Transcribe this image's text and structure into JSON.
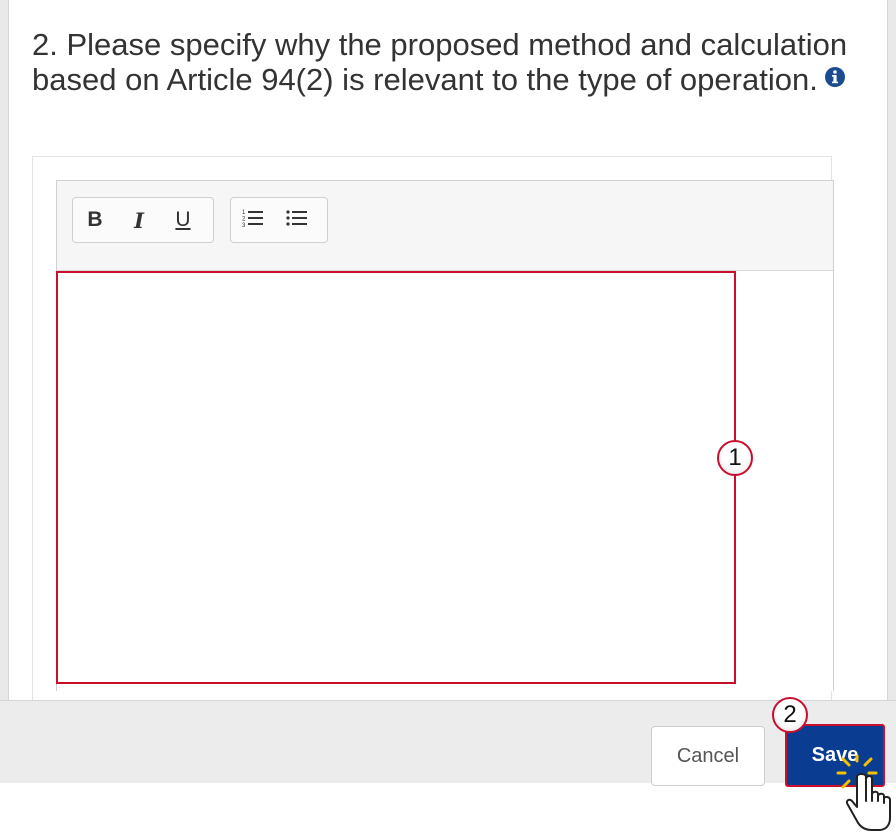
{
  "question": {
    "text": "2. Please specify why the proposed method and calculation based on Article 94(2) is relevant to the type of operation.",
    "info_icon": "info-icon"
  },
  "toolbar": {
    "bold_label": "B",
    "italic_label": "I",
    "underline_label": "U",
    "ordered_list_icon": "ordered-list-icon",
    "bullet_list_icon": "bullet-list-icon"
  },
  "editor": {
    "value": ""
  },
  "callouts": {
    "first": "1",
    "second": "2"
  },
  "footer": {
    "cancel_label": "Cancel",
    "save_label": "Save"
  },
  "colors": {
    "highlight": "#c8102e",
    "save_bg": "#0a3d91",
    "info_icon": "#1a4d8f"
  }
}
